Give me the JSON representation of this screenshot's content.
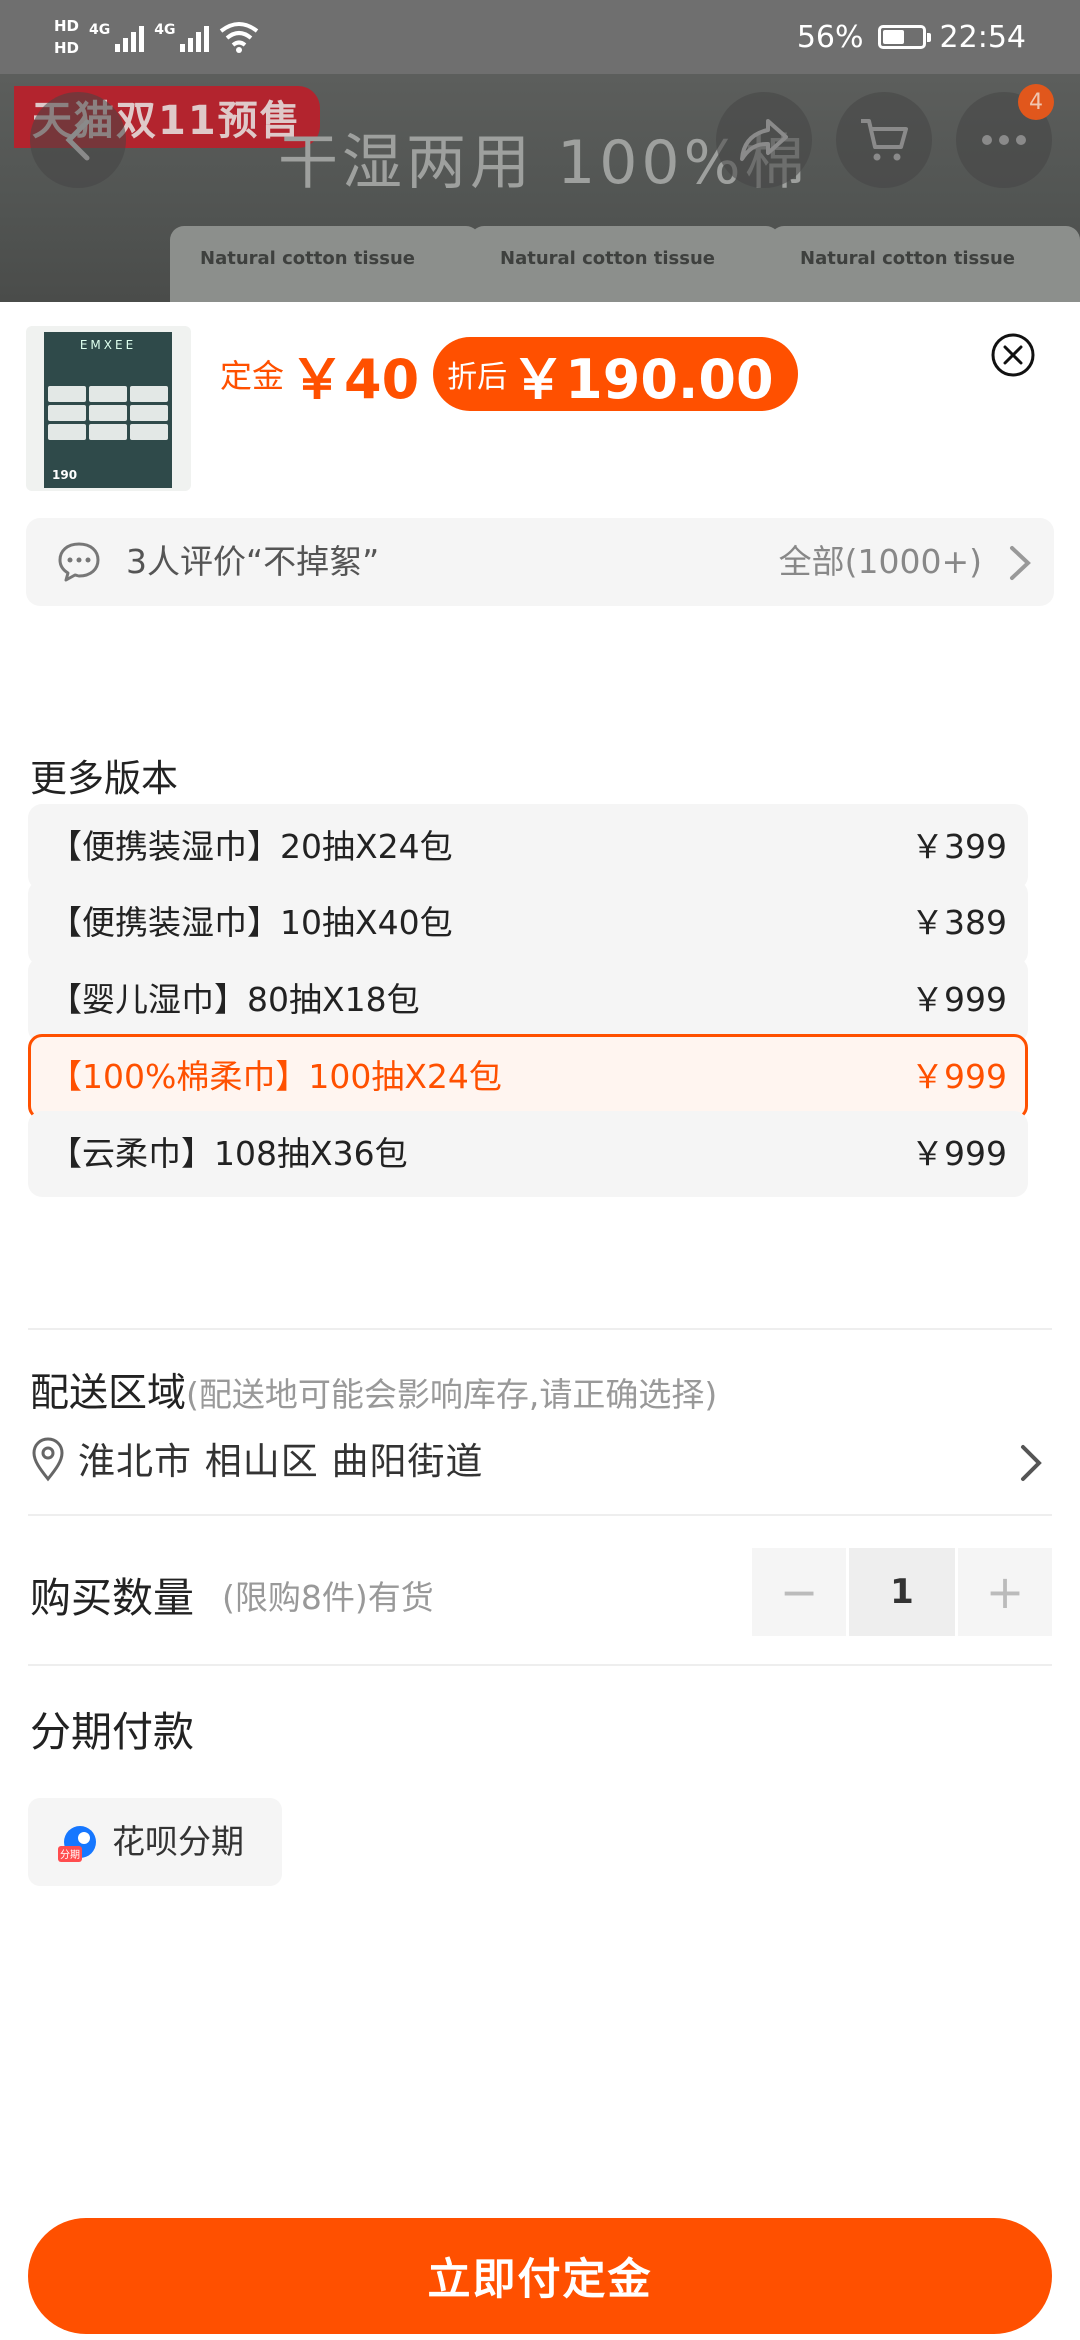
{
  "status_bar": {
    "hd_top": "HD",
    "hd_bottom": "HD",
    "net1": "4G",
    "net2": "4G",
    "battery_percent": "56%",
    "battery_level": 0.56,
    "time": "22:54"
  },
  "banner": {
    "promo_tag": "天猫双11预售",
    "headline": "干湿两用 100%棉",
    "pack_label": "Natural cotton tissue",
    "cart_badge": "4"
  },
  "product": {
    "thumb_brand": "EMXEE",
    "thumb_price": "190",
    "deposit_label": "定金",
    "deposit_amount": "￥40",
    "after_label": "折后",
    "after_amount": "￥190.00"
  },
  "review": {
    "text": "3人评价“不掉絮”",
    "all_label": "全部(1000+)"
  },
  "versions": {
    "title": "更多版本",
    "items": [
      {
        "name": "【便携装湿巾】20抽X24包",
        "price": "￥399",
        "selected": false
      },
      {
        "name": "【便携装湿巾】10抽X40包",
        "price": "￥389",
        "selected": false
      },
      {
        "name": "【婴儿湿巾】80抽X18包",
        "price": "￥999",
        "selected": false
      },
      {
        "name": "【100%棉柔巾】100抽X24包",
        "price": "￥999",
        "selected": true
      },
      {
        "name": "【云柔巾】108抽X36包",
        "price": "￥999",
        "selected": false
      }
    ]
  },
  "delivery": {
    "title": "配送区域",
    "hint": "(配送地可能会影响库存,请正确选择)",
    "location": "淮北市 相山区 曲阳街道"
  },
  "quantity": {
    "title": "购买数量",
    "limit": "(限购8件)有货",
    "minus": "−",
    "value": "1",
    "plus": "+"
  },
  "installment": {
    "title": "分期付款",
    "option": "花呗分期",
    "icon_text": "分期"
  },
  "actions": {
    "pay": "立即付定金"
  },
  "colors": {
    "accent": "#ff5000",
    "selected_bg": "#fff5f0",
    "chip_bg": "#f5f5f5"
  }
}
